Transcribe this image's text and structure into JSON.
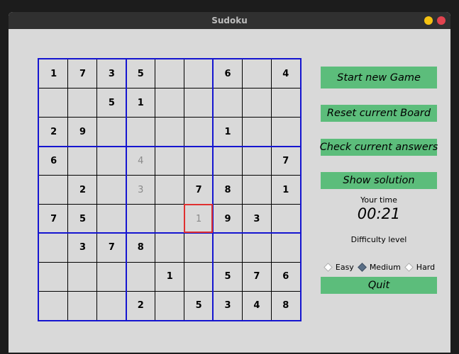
{
  "window": {
    "title": "Sudoku"
  },
  "board": {
    "cells": [
      [
        "1",
        "7",
        "3",
        "5",
        "",
        "",
        "6",
        "",
        "4"
      ],
      [
        "",
        "",
        "5",
        "1",
        "",
        "",
        "",
        "",
        ""
      ],
      [
        "2",
        "9",
        "",
        "",
        "",
        "",
        "1",
        "",
        ""
      ],
      [
        "6",
        "",
        "",
        "4",
        "",
        "",
        "",
        "",
        "7"
      ],
      [
        "",
        "2",
        "",
        "3",
        "",
        "7",
        "8",
        "",
        "1"
      ],
      [
        "7",
        "5",
        "",
        "",
        "",
        "1",
        "9",
        "3",
        ""
      ],
      [
        "",
        "3",
        "7",
        "8",
        "",
        "",
        "",
        "",
        ""
      ],
      [
        "",
        "",
        "",
        "",
        "1",
        "",
        "5",
        "7",
        "6"
      ],
      [
        "",
        "",
        "",
        "2",
        "",
        "5",
        "3",
        "4",
        "8"
      ]
    ],
    "user_entries": [
      [
        3,
        3
      ],
      [
        4,
        3
      ],
      [
        5,
        5
      ]
    ],
    "selected_cell": [
      5,
      5
    ]
  },
  "controls": {
    "start_new_game": "Start new Game",
    "reset_board": "Reset current Board",
    "check_answers": "Check current answers",
    "show_solution": "Show solution",
    "quit": "Quit"
  },
  "timer": {
    "label": "Your time",
    "value": "00:21"
  },
  "difficulty": {
    "label": "Difficulty level",
    "options": [
      "Easy",
      "Medium",
      "Hard"
    ],
    "selected": "Medium"
  },
  "colors": {
    "button_green": "#5cbd7b",
    "box_border_blue": "#1515d0",
    "selected_red": "#e03030",
    "user_entry_gray": "#8a8a8a"
  }
}
